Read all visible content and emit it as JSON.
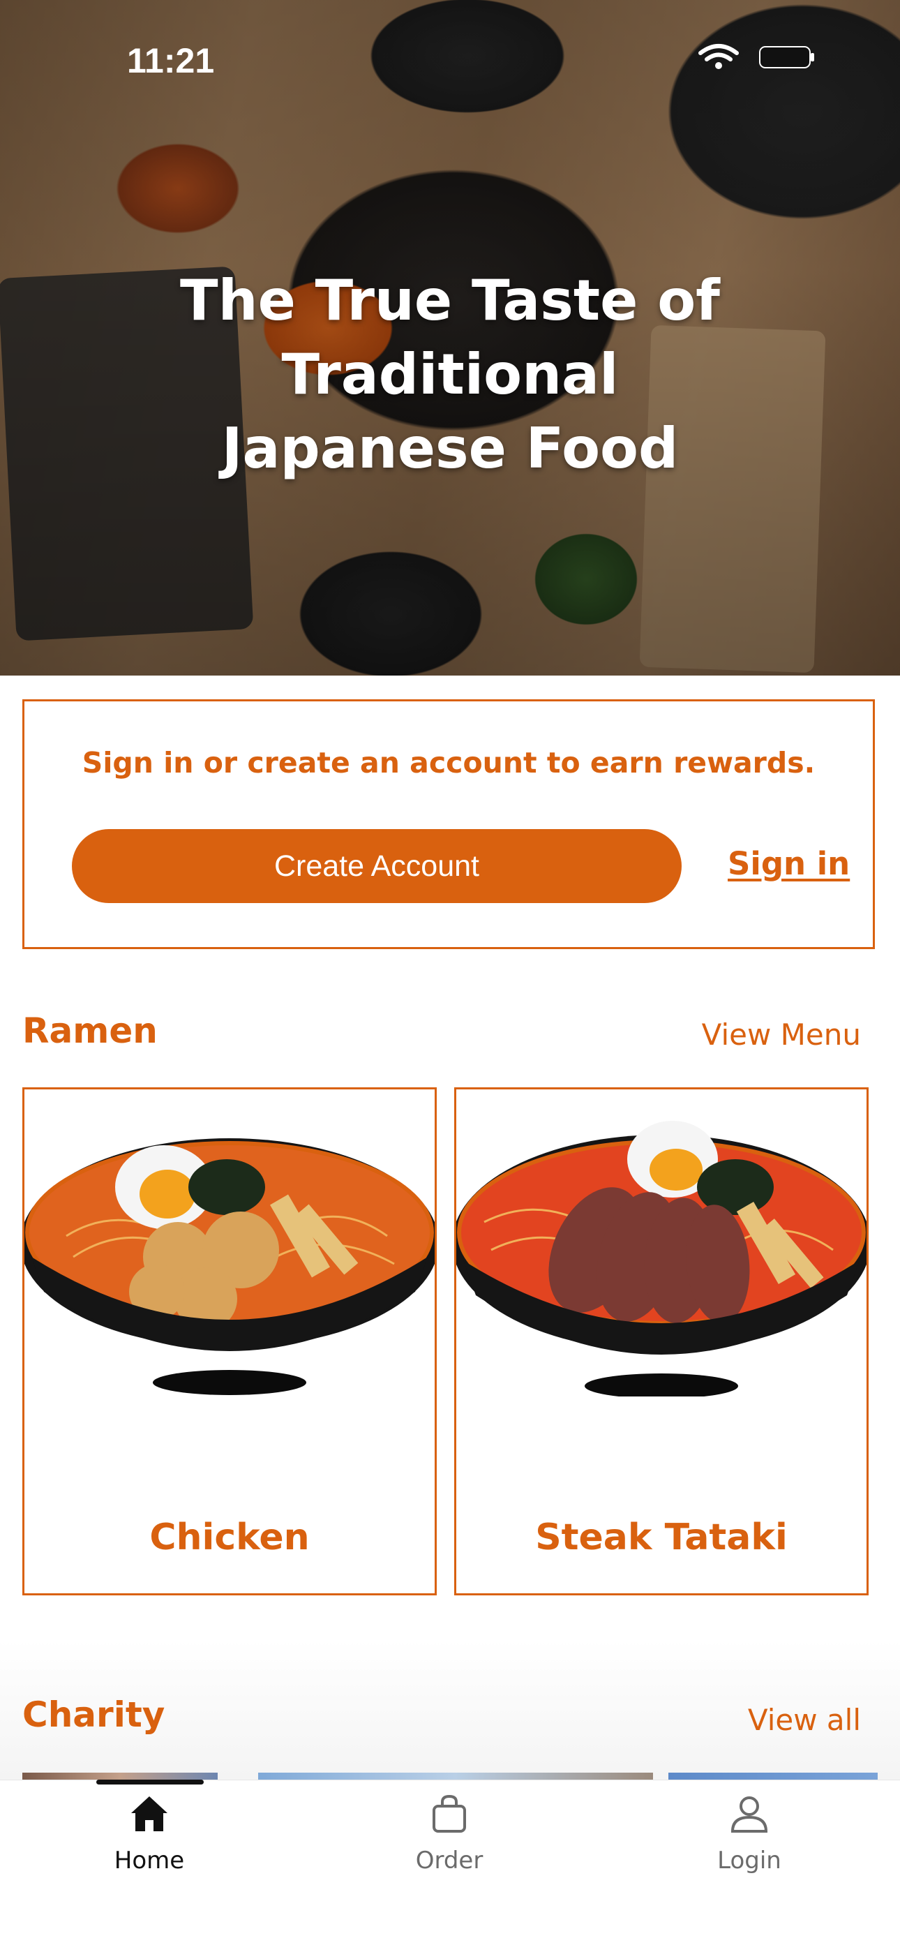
{
  "status_bar": {
    "time": "11:21",
    "icons": [
      "wifi-icon",
      "battery-icon"
    ]
  },
  "hero": {
    "title_line1": "The True Taste of Traditional",
    "title_line2": "Japanese Food"
  },
  "rewards": {
    "message": "Sign in or create an account to earn rewards.",
    "create_account_label": "Create Account",
    "sign_in_label": "Sign in"
  },
  "ramen_section": {
    "title": "Ramen",
    "link_label": "View Menu",
    "items": [
      {
        "name": "Chicken"
      },
      {
        "name": "Steak Tataki"
      }
    ]
  },
  "charity_section": {
    "title": "Charity",
    "link_label": "View all"
  },
  "tab_bar": {
    "tabs": [
      {
        "label": "Home",
        "icon": "home-icon",
        "active": true
      },
      {
        "label": "Order",
        "icon": "bag-icon",
        "active": false
      },
      {
        "label": "Login",
        "icon": "person-icon",
        "active": false
      }
    ]
  },
  "colors": {
    "accent": "#d9610f",
    "active_tab": "#111111",
    "inactive_tab": "#6b6b6b"
  }
}
